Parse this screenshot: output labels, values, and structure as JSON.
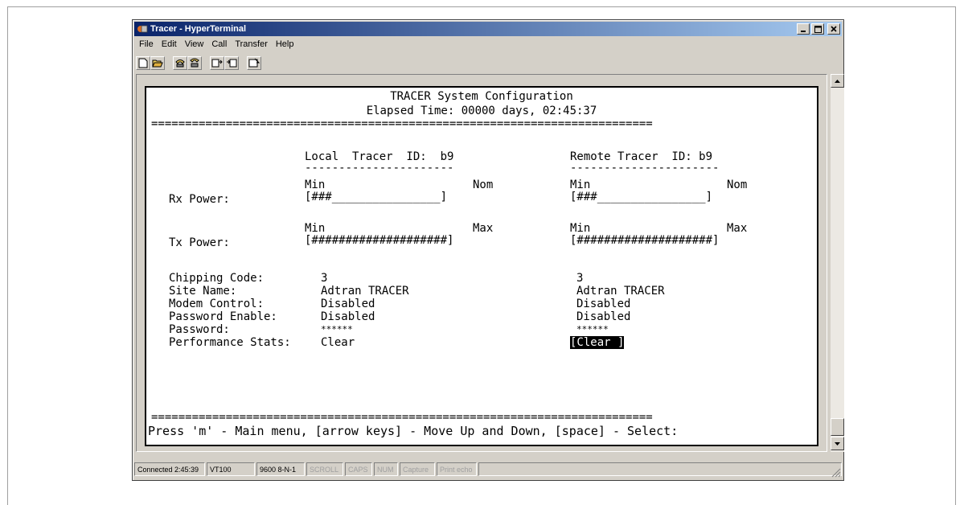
{
  "window": {
    "title": "Tracer - HyperTerminal",
    "buttons": {
      "minimize": "_",
      "maximize": "□",
      "close": "×"
    }
  },
  "menubar": [
    "File",
    "Edit",
    "View",
    "Call",
    "Transfer",
    "Help"
  ],
  "toolbar": {
    "icons": [
      "new-document-icon",
      "open-folder-icon",
      "call-icon",
      "disconnect-icon",
      "send-icon",
      "receive-icon",
      "properties-icon"
    ]
  },
  "terminal": {
    "title": "TRACER System Configuration",
    "elapsed": "Elapsed Time: 00000 days, 02:45:37",
    "separator": "==========================================================================",
    "local_header": "Local  Tracer  ID:  b9",
    "remote_header": "Remote Tracer  ID: b9",
    "header_underline": "----------------------",
    "rx": {
      "label": "Rx Power:",
      "scale_min": "Min",
      "scale_max": "Nom",
      "local_bar": "[###________________]",
      "remote_bar": "[###________________]"
    },
    "tx": {
      "label": "Tx Power:",
      "scale_min": "Min",
      "scale_max": "Max",
      "local_bar": "[####################]",
      "remote_bar": "[####################]"
    },
    "settings": [
      {
        "label": "Chipping Code:",
        "local": "3",
        "remote": "3"
      },
      {
        "label": "Site Name:",
        "local": "Adtran TRACER",
        "remote": "Adtran TRACER"
      },
      {
        "label": "Modem Control:",
        "local": "Disabled",
        "remote": "Disabled"
      },
      {
        "label": "Password Enable:",
        "local": "Disabled",
        "remote": "Disabled"
      },
      {
        "label": "Password:",
        "local": "******",
        "remote": "******"
      },
      {
        "label": "Performance Stats:",
        "local": "Clear",
        "remote": "[Clear ]"
      }
    ],
    "prompt": "Press 'm' - Main menu, [arrow keys] - Move Up and Down, [space] - Select:"
  },
  "statusbar": {
    "connected": "Connected 2:45:39",
    "emulation": "VT100",
    "settings": "9600 8-N-1",
    "scroll": "SCROLL",
    "caps": "CAPS",
    "num": "NUM",
    "capture": "Capture",
    "print": "Print echo"
  }
}
